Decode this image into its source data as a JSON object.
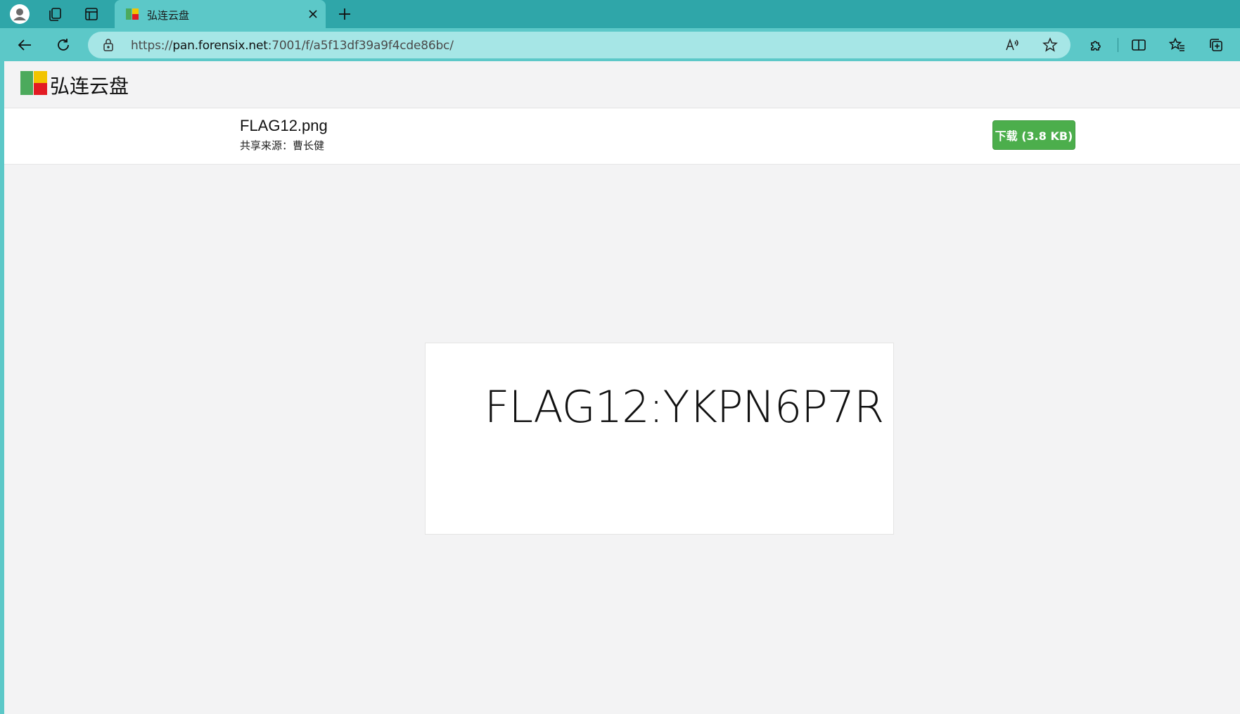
{
  "browser": {
    "tab": {
      "title": "弘连云盘",
      "favicon": "site-logo"
    },
    "address_bar": {
      "scheme": "https://",
      "host": "pan.forensix.net",
      "path": ":7001/f/a5f13df39a9f4cde86bc/"
    },
    "icons": {
      "profile": "profile-icon",
      "workspaces": "workspaces-icon",
      "tab_actions": "tab-actions-icon",
      "close_tab": "close-icon",
      "new_tab": "plus-icon",
      "back": "back-arrow-icon",
      "refresh": "refresh-icon",
      "lock": "lock-icon",
      "read_aloud": "read-aloud-icon",
      "favorite": "star-icon",
      "extensions": "puzzle-icon",
      "split_screen": "split-screen-icon",
      "favorites": "favorites-icon",
      "collections": "collections-icon"
    },
    "colors": {
      "tab_strip": "#2fa6a9",
      "toolbar": "#5cc8c8",
      "address_bar": "#a6e6e6"
    }
  },
  "site": {
    "name": "弘连云盘",
    "logo_colors": [
      "#4caa5c",
      "#f2c400",
      "#e31b23"
    ]
  },
  "file": {
    "name": "FLAG12.png",
    "share_label": "共享来源：",
    "share_owner": "曹长健",
    "download_label": "下载 (3.8 KB)",
    "download_color": "#4cae4c"
  },
  "preview": {
    "text": "FLAG12:YKPN6P7R"
  }
}
